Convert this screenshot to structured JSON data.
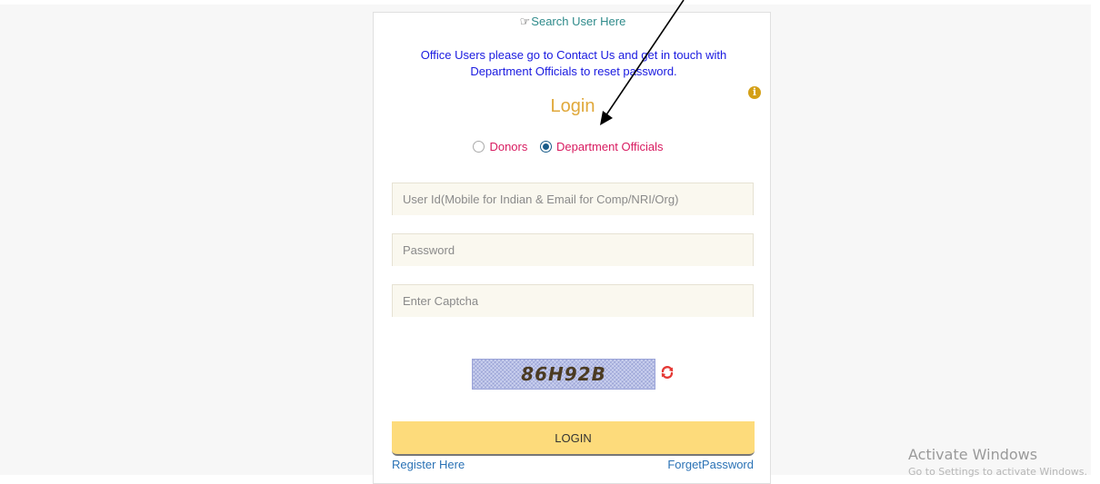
{
  "search": {
    "label": "Search User Here",
    "icon": "hand-pointing-icon"
  },
  "notice": {
    "text": "Office Users please go to Contact Us and get in touch with Department Officials to reset password."
  },
  "login": {
    "title": "Login",
    "user_types": [
      {
        "label": "Donors",
        "selected": false
      },
      {
        "label": "Department Officials",
        "selected": true
      }
    ],
    "fields": {
      "user_id_placeholder": "User Id(Mobile for Indian & Email for Comp/NRI/Org)",
      "password_placeholder": "Password",
      "captcha_placeholder": "Enter Captcha"
    },
    "captcha_text": "86H92B",
    "button_label": "LOGIN",
    "register_link": "Register Here",
    "forget_link": "ForgetPassword"
  },
  "watermark": {
    "title": "Activate Windows",
    "subtitle": "Go to Settings to activate Windows."
  },
  "colors": {
    "accent_title": "#e0a83a",
    "link": "#2a72b5",
    "radio_label": "#d81b60",
    "button": "#fddb7b",
    "notice": "#1a1ae0"
  }
}
